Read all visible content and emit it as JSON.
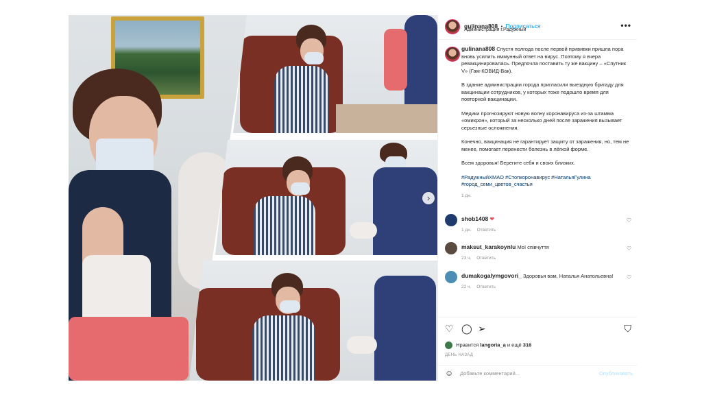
{
  "post": {
    "username": "gulinana808",
    "separator": "•",
    "follow_label": "Подписаться",
    "location": "Администрация г.Радужный",
    "more_icon": "more-dots-icon",
    "caption_paragraphs": [
      "Спустя полгода после первой прививки пришла пора вновь усилить иммунный ответ на вирус. Поэтому я вчера ревакцинировалась. Предпочла поставить ту же вакцину – «Спутник V» (Гам-КОВИД-Вак).",
      "В здание администрации города пригласили выездную бригаду для вакцинации сотрудников, у которых тоже подошло время для повторной вакцинации.",
      "Медики прогнозируют новую волну коронавируса из-за штамма «омикрон», который за несколько дней после заражения вызывает серьезные осложнения.",
      "Конечно, вакцинация не гарантирует защиту от заражения, но, тем не менее, помогает перенести болезнь в лёгкой форме.",
      "Всем здоровья! Берегите себя и своих близких."
    ],
    "hashtags": "#РадужныйХМАО #Стопкоронавирус #НатальяГулина #город_семи_цветов_счастья",
    "caption_age": "1 дн."
  },
  "comments": [
    {
      "username": "shob1408",
      "text": "",
      "has_heart": true,
      "age": "1 дн.",
      "reply_label": "Ответить",
      "avatar_color": "#1f3b6e"
    },
    {
      "username": "maksut_karakoynlu",
      "text": "Мої співчуття",
      "has_heart": false,
      "age": "23 ч.",
      "reply_label": "Ответить",
      "avatar_color": "#5b4a3f"
    },
    {
      "username": "dumakogalymgovori_",
      "text": "Здоровья вам, Наталья Анатольевна!",
      "has_heart": false,
      "age": "22 ч.",
      "reply_label": "Ответить",
      "avatar_color": "#4b8db5"
    }
  ],
  "actions": {
    "like_icon": "heart-outline-icon",
    "comment_icon": "comment-icon",
    "share_icon": "send-icon",
    "save_icon": "bookmark-icon"
  },
  "likes": {
    "prefix": "Нравится",
    "user": "langoria_a",
    "connector": "и ещё",
    "count": "316"
  },
  "posted_when": "ДЕНЬ НАЗАД",
  "add_comment": {
    "placeholder": "Добавьте комментарий...",
    "publish_label": "Опубликовать"
  },
  "colors": {
    "link": "#0095f6",
    "hashtag": "#00376b",
    "muted": "#8e8e8e",
    "heart_red": "#ed4956"
  }
}
